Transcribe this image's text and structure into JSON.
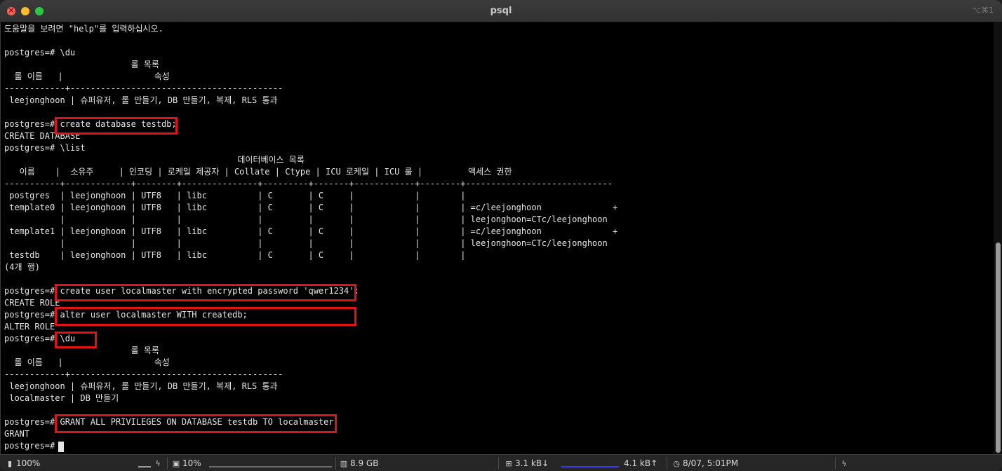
{
  "window": {
    "title": "psql",
    "shortcut": "⌥⌘1",
    "close_glyph": "×"
  },
  "terminal": {
    "lines": [
      "도움말을 보려면 \"help\"를 입력하십시오.",
      "",
      "postgres=# \\du",
      "                         롤 목록",
      "  롤 이름   |                  속성",
      "------------+------------------------------------------",
      " leejonghoon | 슈퍼유저, 롤 만들기, DB 만들기, 복제, RLS 통과",
      "",
      "postgres=# create database testdb;",
      "CREATE DATABASE",
      "postgres=# \\list",
      "                                              데이터베이스 목록",
      "   이름    |  소유주     | 인코딩 | 로케일 제공자 | Collate | Ctype | ICU 로케일 | ICU 룰 |         액세스 권한",
      "-----------+-------------+--------+---------------+---------+-------+------------+--------+-----------------------------",
      " postgres  | leejonghoon | UTF8   | libc          | C       | C     |            |        |",
      " template0 | leejonghoon | UTF8   | libc          | C       | C     |            |        | =c/leejonghoon              +",
      "           |             |        |               |         |       |            |        | leejonghoon=CTc/leejonghoon",
      " template1 | leejonghoon | UTF8   | libc          | C       | C     |            |        | =c/leejonghoon              +",
      "           |             |        |               |         |       |            |        | leejonghoon=CTc/leejonghoon",
      " testdb    | leejonghoon | UTF8   | libc          | C       | C     |            |        |",
      "(4개 행)",
      "",
      "postgres=# create user localmaster with encrypted password 'qwer1234';",
      "CREATE ROLE",
      "postgres=# alter user localmaster WITH createdb;",
      "ALTER ROLE",
      "postgres=# \\du",
      "                         롤 목록",
      "  롤 이름   |                  속성",
      "------------+------------------------------------------",
      " leejonghoon | 슈퍼유저, 롤 만들기, DB 만들기, 복제, RLS 통과",
      " localmaster | DB 만들기",
      "",
      "postgres=# GRANT ALL PRIVILEGES ON DATABASE testdb TO localmaster;",
      "GRANT",
      "postgres=# "
    ]
  },
  "statusbar": {
    "battery": "100%",
    "cpu": "10%",
    "memory": "8.9 GB",
    "download": "3.1 kB↓",
    "upload": "4.1 kB↑",
    "datetime": "8/07, 5:01PM"
  },
  "colors": {
    "highlight": "#e01414",
    "spark_cpu": "#9c9c9c",
    "spark_net": "#3a3aff"
  }
}
